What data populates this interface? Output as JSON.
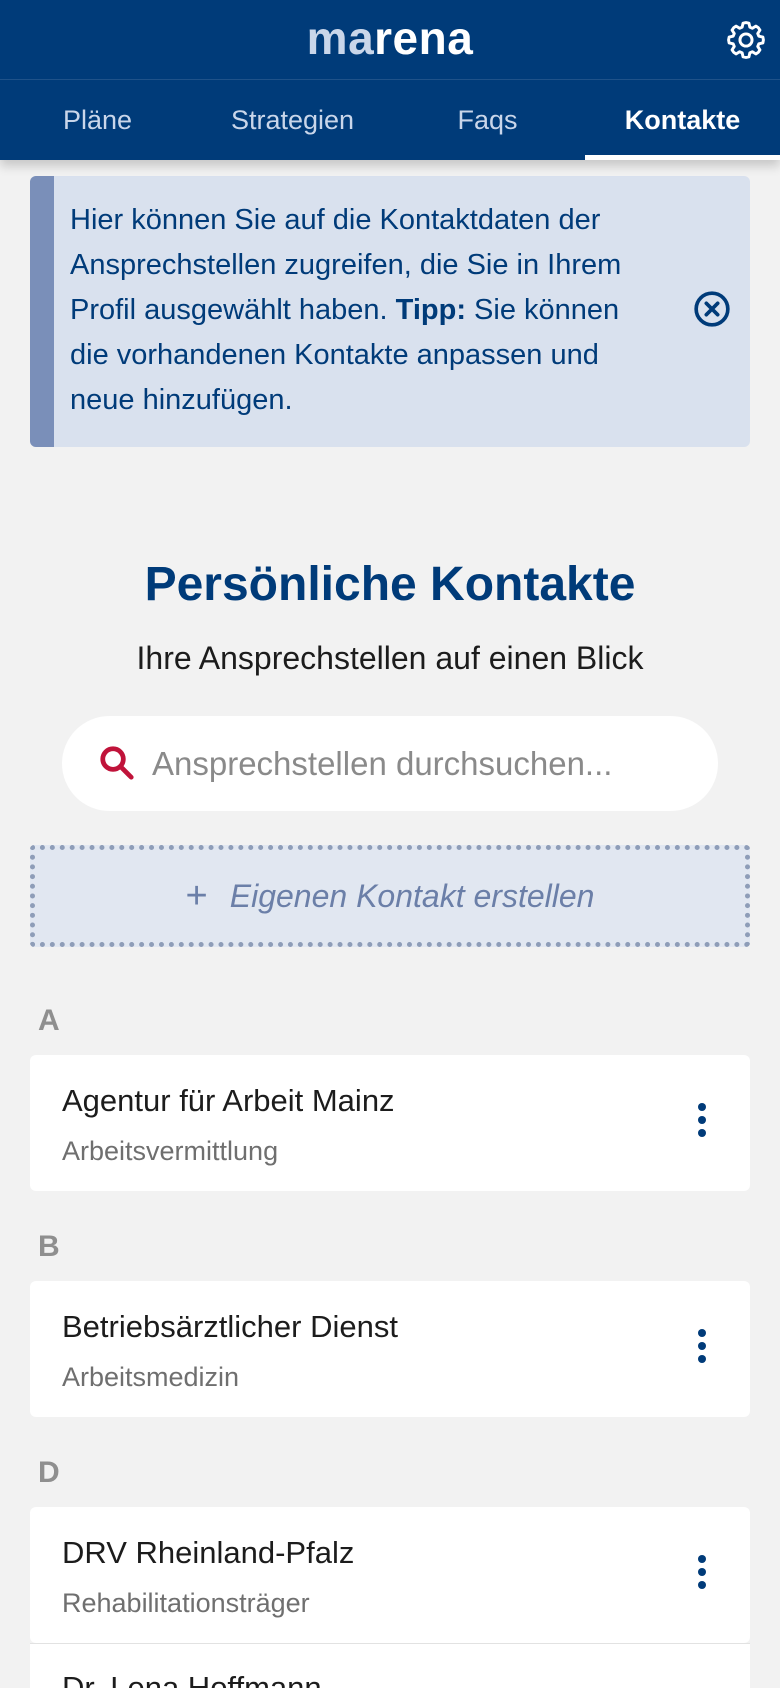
{
  "header": {
    "logo_pre": "ma",
    "logo_post": "rena",
    "settings_icon": "gear-icon"
  },
  "tabs": [
    {
      "label": "Pläne",
      "active": false
    },
    {
      "label": "Strategien",
      "active": false
    },
    {
      "label": "Faqs",
      "active": false
    },
    {
      "label": "Kontakte",
      "active": true
    }
  ],
  "info": {
    "text_before": "Hier können Sie auf die Kontaktdaten der Ansprechstellen zugreifen, die Sie in Ihrem Profil ausgewählt haben. ",
    "tip_label": "Tipp:",
    "text_after": " Sie können die vorhandenen Kontakte anpassen und neue hinzufügen.",
    "close_icon": "close-circle-icon"
  },
  "page": {
    "title": "Persönliche Kontakte",
    "subtitle": "Ihre Ansprechstellen auf einen Blick"
  },
  "search": {
    "placeholder": "Ansprechstellen durchsuchen...",
    "value": "",
    "icon": "search-icon"
  },
  "create": {
    "plus": "+",
    "label": "Eigenen Kontakt erstellen"
  },
  "groups": [
    {
      "letter": "A",
      "contacts": [
        {
          "name": "Agentur für Arbeit Mainz",
          "category": "Arbeitsvermittlung"
        }
      ]
    },
    {
      "letter": "B",
      "contacts": [
        {
          "name": "Betriebsärztlicher Dienst",
          "category": "Arbeitsmedizin"
        }
      ]
    },
    {
      "letter": "D",
      "contacts": [
        {
          "name": "DRV Rheinland-Pfalz",
          "category": "Rehabilitationsträger"
        },
        {
          "name": "Dr. Lena Hoffmann",
          "category": ""
        }
      ]
    }
  ],
  "colors": {
    "primary": "#003b79",
    "banner_bg": "#d9e1ee",
    "banner_accent": "#7a8fb9",
    "search_icon": "#c0133a",
    "background": "#f2f2f2"
  }
}
